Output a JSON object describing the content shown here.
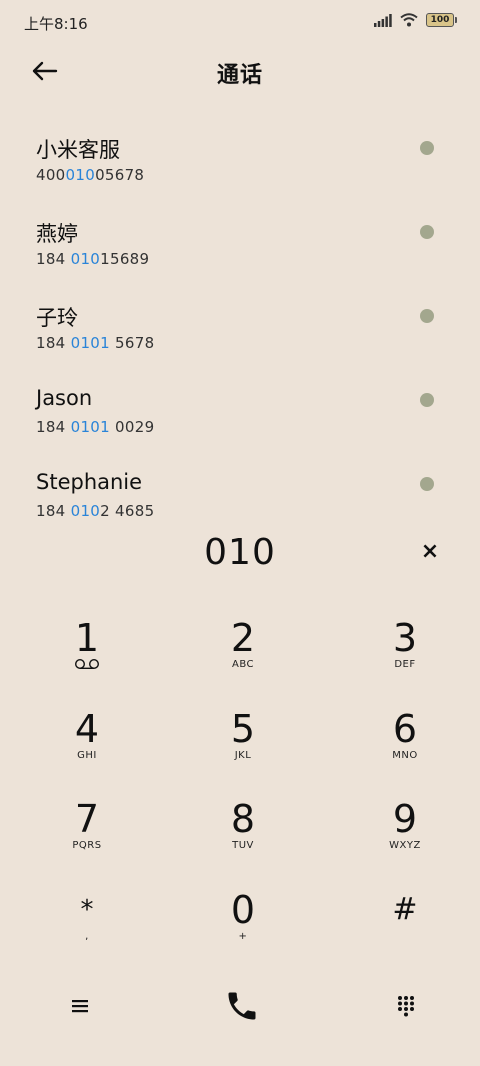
{
  "status_bar": {
    "time": "上午8:16",
    "battery": "100"
  },
  "header": {
    "title": "通话"
  },
  "contacts": [
    {
      "name": "小米客服",
      "num_pre": "400",
      "num_hl": "010",
      "num_post": "05678"
    },
    {
      "name": "燕婷",
      "num_pre": "184 ",
      "num_hl": "010",
      "num_post": "15689"
    },
    {
      "name": "子玲",
      "num_pre": "184 ",
      "num_hl": "0101",
      "num_post": " 5678"
    },
    {
      "name": "Jason",
      "num_pre": "184 ",
      "num_hl": "0101",
      "num_post": " 0029"
    },
    {
      "name": "Stephanie",
      "num_pre": "184 ",
      "num_hl": "010",
      "num_post": "2 4685"
    }
  ],
  "dialer": {
    "number": "010",
    "clear_label": "×"
  },
  "keypad": [
    {
      "digit": "1",
      "letters": ""
    },
    {
      "digit": "2",
      "letters": "ABC"
    },
    {
      "digit": "3",
      "letters": "DEF"
    },
    {
      "digit": "4",
      "letters": "GHI"
    },
    {
      "digit": "5",
      "letters": "JKL"
    },
    {
      "digit": "6",
      "letters": "MNO"
    },
    {
      "digit": "7",
      "letters": "PQRS"
    },
    {
      "digit": "8",
      "letters": "TUV"
    },
    {
      "digit": "9",
      "letters": "WXYZ"
    },
    {
      "digit": "*",
      "letters": ","
    },
    {
      "digit": "0",
      "letters": "+"
    },
    {
      "digit": "#",
      "letters": ""
    }
  ],
  "icons": {
    "back": "arrow-left-icon",
    "voicemail": "voicemail-icon",
    "menu": "menu-icon",
    "call": "phone-icon",
    "dialpad": "dialpad-icon"
  },
  "colors": {
    "background": "#ede3d8",
    "highlight": "#2a84d8",
    "dot": "#a3a78e"
  }
}
